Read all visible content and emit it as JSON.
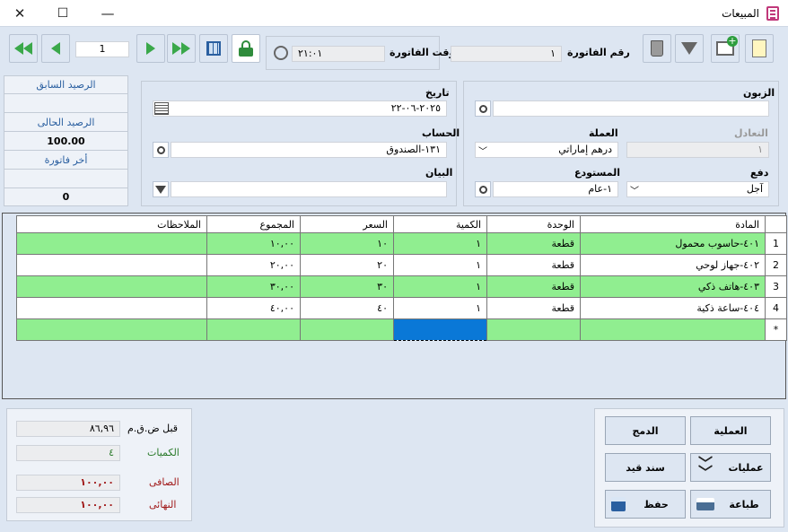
{
  "window": {
    "title": "المبيعات",
    "close": "✕",
    "maximize": "☐",
    "minimize": "—"
  },
  "header": {
    "invoice_no_label": "رقم الفاتورة",
    "invoice_no_value": "١",
    "invoice_time_label": "وقت الفاتورة",
    "invoice_time_value": "٢١:٠١",
    "nav_value": "1"
  },
  "side": {
    "prev_balance_label": "الرصيد السابق",
    "prev_balance_value": "",
    "current_balance_label": "الرصيد الحالى",
    "current_balance_value": "100.00",
    "last_invoice_label": "أخر فاتورة",
    "last_invoice_value": "",
    "bottom_value": "0"
  },
  "form": {
    "date_label": "تاريخ",
    "date_value": "٢٠٢٥-٠٦-٢٢",
    "account_label": "الحساب",
    "account_value": "١٣١-الصندوق",
    "statement_label": "البيان",
    "statement_value": "",
    "customer_label": "الزبون",
    "customer_value": "",
    "rate_label": "التعادل",
    "rate_value": "١",
    "currency_label": "العملة",
    "currency_value": "درهم إماراتي",
    "payment_label": "دفع",
    "payment_value": "آجل",
    "warehouse_label": "المستودع",
    "warehouse_value": "١-عام"
  },
  "grid": {
    "headers": [
      "المادة",
      "الوحدة",
      "الكمية",
      "السعر",
      "المجموع",
      "الملاحظات"
    ],
    "rows": [
      {
        "num": "1",
        "item": "٤٠١-حاسوب محمول",
        "unit": "قطعة",
        "qty": "١",
        "price": "١٠",
        "total": "١٠,٠٠",
        "notes": ""
      },
      {
        "num": "2",
        "item": "٤٠٢-جهاز لوحي",
        "unit": "قطعة",
        "qty": "١",
        "price": "٢٠",
        "total": "٢٠,٠٠",
        "notes": ""
      },
      {
        "num": "3",
        "item": "٤٠٣-هاتف ذكي",
        "unit": "قطعة",
        "qty": "١",
        "price": "٣٠",
        "total": "٣٠,٠٠",
        "notes": ""
      },
      {
        "num": "4",
        "item": "٤٠٤-ساعة ذكية",
        "unit": "قطعة",
        "qty": "١",
        "price": "٤٠",
        "total": "٤٠,٠٠",
        "notes": ""
      }
    ],
    "new_row_marker": "*"
  },
  "totals": {
    "before_tax_label": "قبل ض.ق.م",
    "before_tax_value": "٨٦,٩٦",
    "quantities_label": "الكميات",
    "quantities_value": "٤",
    "net_label": "الصافى",
    "net_value": "١٠٠,٠٠",
    "final_label": "النهائى",
    "final_value": "١٠٠,٠٠"
  },
  "buttons": {
    "operation": "العملية",
    "merge": "الدمج",
    "operations": "عمليات",
    "journal": "سند قيد",
    "print": "طباعة",
    "save": "حفظ"
  },
  "colors": {
    "green_row": "#90ee90",
    "selected": "#0a78d7",
    "accent": "#3aa84a"
  }
}
